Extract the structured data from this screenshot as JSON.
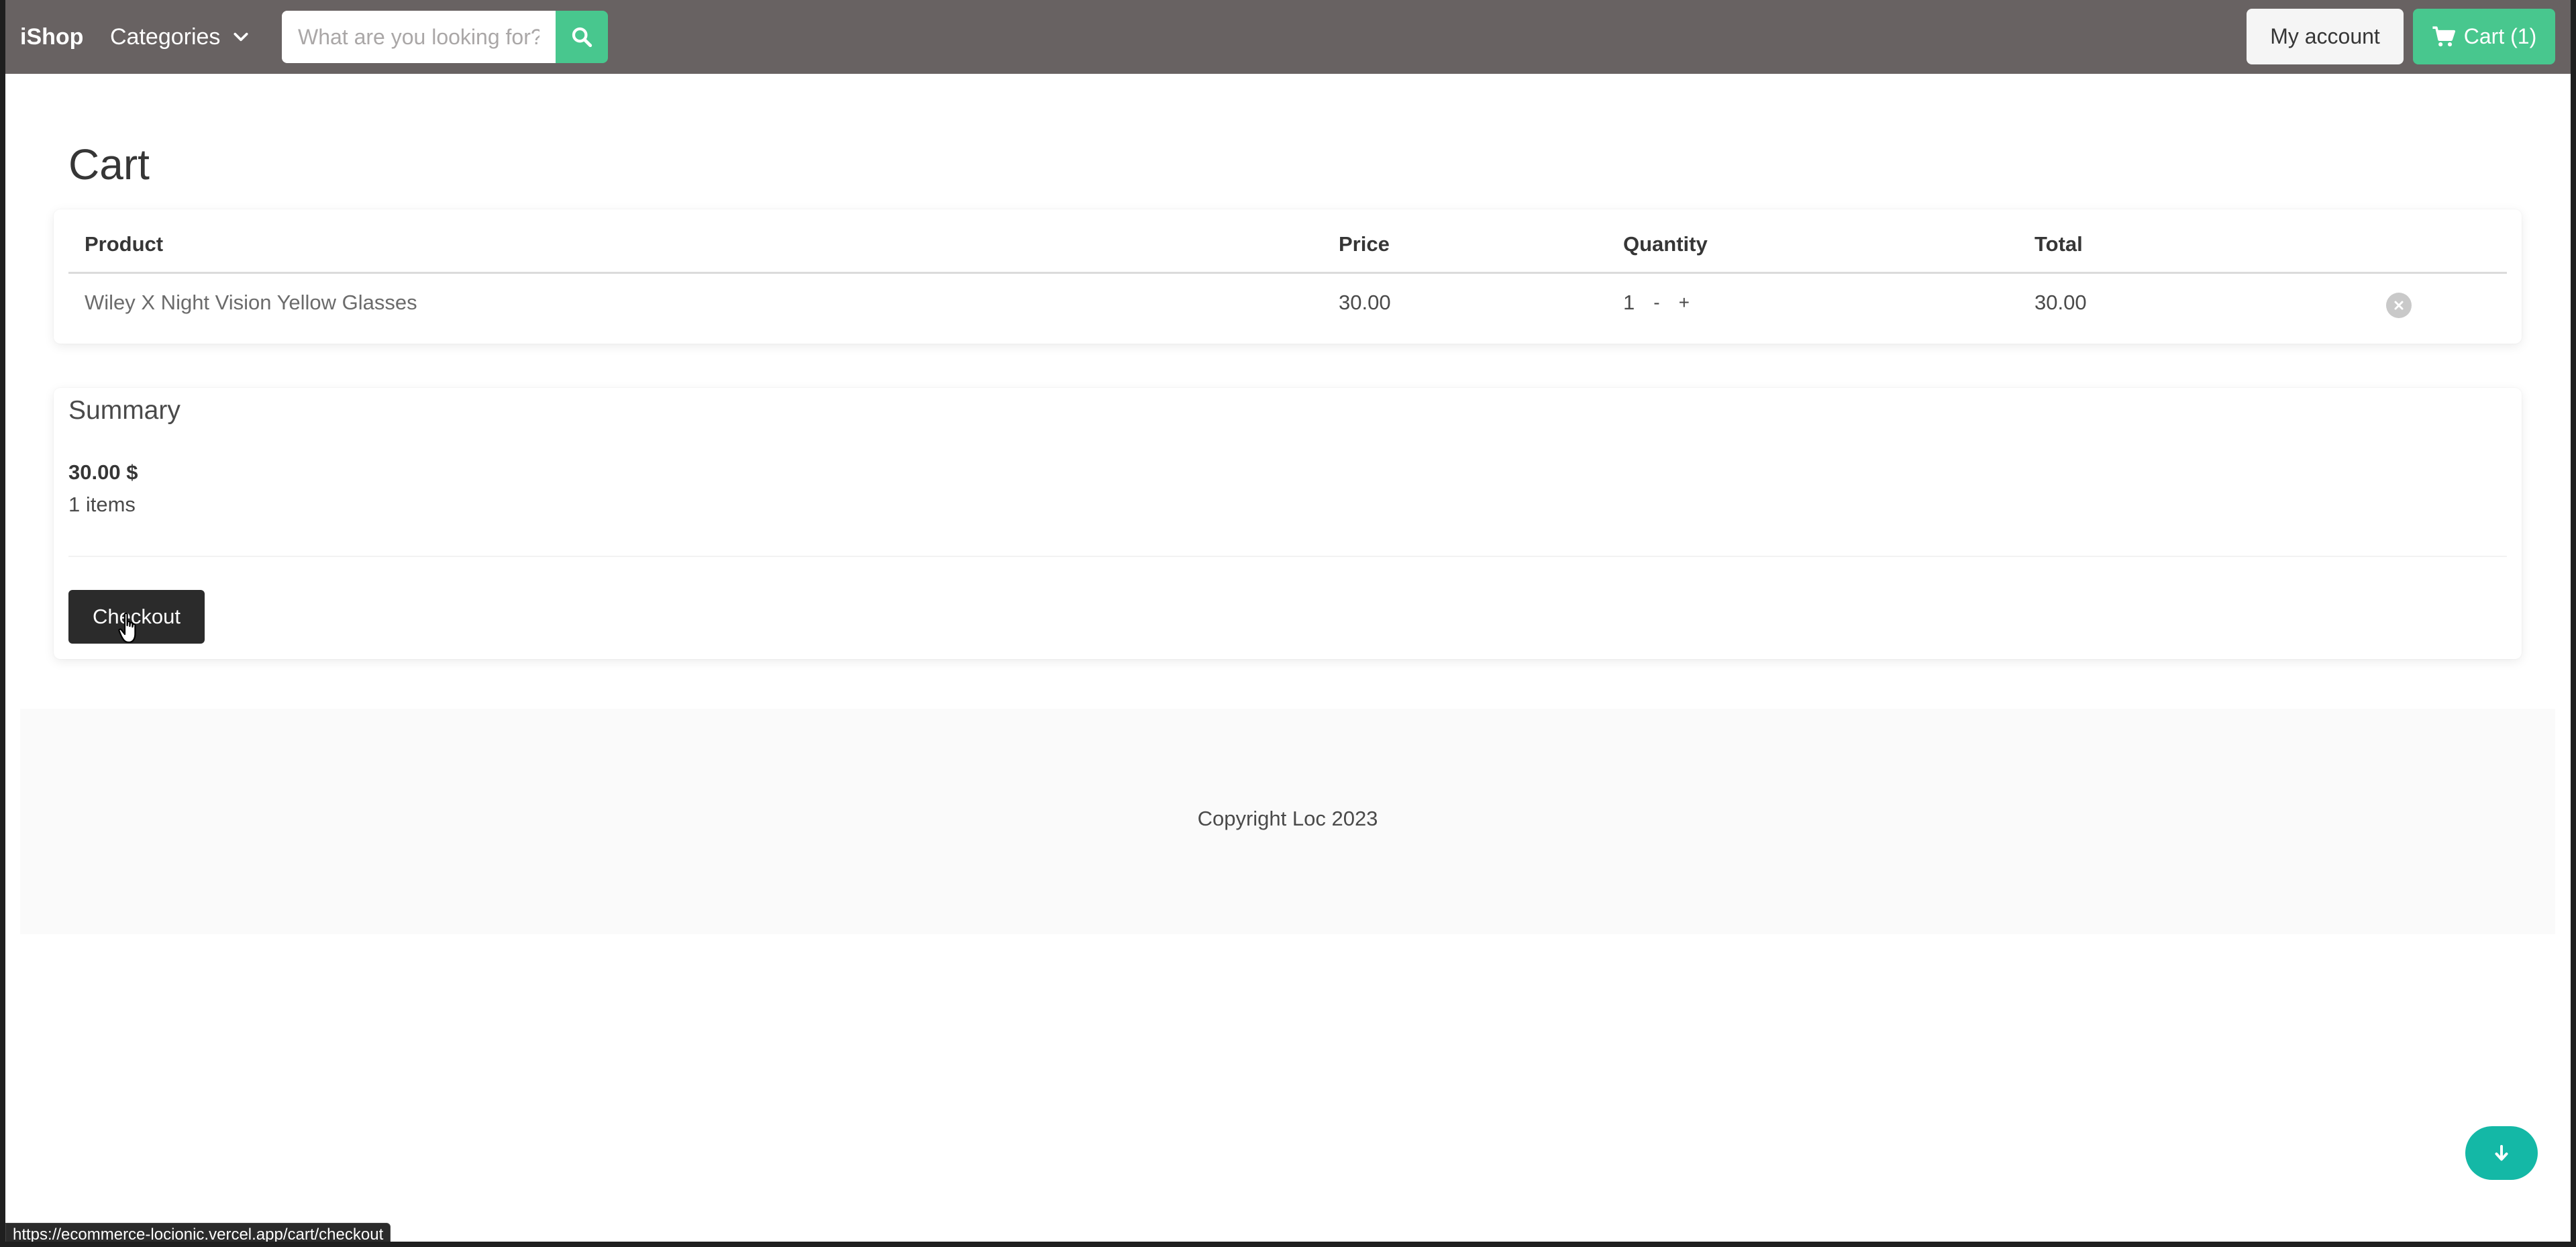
{
  "navbar": {
    "brand": "iShop",
    "categories_label": "Categories",
    "search_placeholder": "What are you looking for?",
    "account_label": "My account",
    "cart_label": "Cart (1)"
  },
  "page": {
    "title": "Cart"
  },
  "cart_table": {
    "headers": {
      "product": "Product",
      "price": "Price",
      "quantity": "Quantity",
      "total": "Total"
    },
    "rows": [
      {
        "product": "Wiley X Night Vision Yellow Glasses",
        "price": "30.00",
        "quantity": "1",
        "decrement": "-",
        "increment": "+",
        "total": "30.00"
      }
    ]
  },
  "summary": {
    "title": "Summary",
    "total": "30.00 $",
    "items": "1 items",
    "checkout_label": "Checkout"
  },
  "footer": {
    "copyright": "Copyright Loc 2023"
  },
  "status_bar": {
    "url": "https://ecommerce-locionic.vercel.app/cart/checkout"
  },
  "colors": {
    "navbar": "#686262",
    "accent": "#48c78e",
    "fab": "#14b8a6",
    "checkout": "#2b2b2b"
  },
  "icons": {
    "search": "search-icon",
    "chevron": "chevron-down-icon",
    "cart": "cart-icon",
    "remove": "close-circle-icon",
    "scroll": "arrow-down-icon"
  }
}
